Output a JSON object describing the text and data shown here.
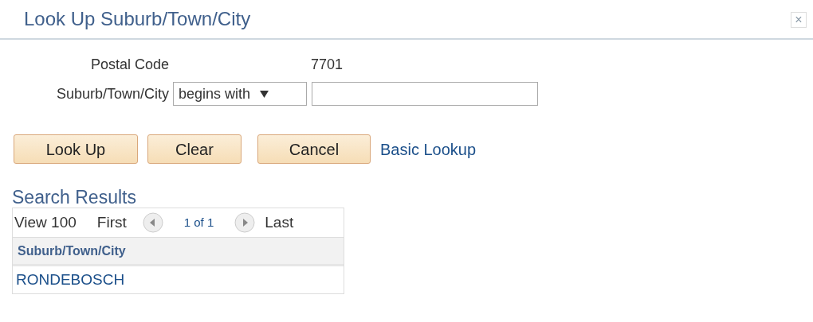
{
  "window": {
    "title": "Look Up Suburb/Town/City",
    "close": "×"
  },
  "fields": [
    {
      "kind": "display",
      "label": "Postal Code",
      "value": "7701"
    },
    {
      "kind": "search",
      "label": "Suburb/Town/City",
      "operator": "begins with"
    }
  ],
  "buttons": [
    {
      "label": "Look Up"
    },
    {
      "label": "Clear"
    },
    {
      "label": "Cancel"
    }
  ],
  "link": "Basic Lookup",
  "results": {
    "title": "Search Results",
    "view": "View 100",
    "first": "First",
    "page": "1 of 1",
    "last": "Last",
    "columns": [
      "Suburb/Town/City"
    ],
    "rows": [
      [
        "RONDEBOSCH"
      ]
    ]
  }
}
